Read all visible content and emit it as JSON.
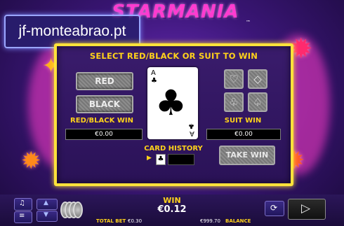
{
  "header": {
    "game_logo": "STARMANIA",
    "trademark": "™"
  },
  "watermark": {
    "text": "jf-monteabrao.pt"
  },
  "gamble": {
    "instruction": "SELECT RED/BLACK OR SUIT TO WIN",
    "red_button": "RED",
    "black_button": "BLACK",
    "red_black_win_label": "RED/BLACK WIN",
    "red_black_win_value": "€0.00",
    "suit_win_label": "SUIT WIN",
    "suit_win_value": "€0.00",
    "card": {
      "rank": "A",
      "suit": "♣"
    },
    "suits": [
      {
        "name": "hearts",
        "glyph": "♡"
      },
      {
        "name": "diamonds",
        "glyph": "◇"
      },
      {
        "name": "clubs",
        "glyph": "♧"
      },
      {
        "name": "spades",
        "glyph": "♤"
      }
    ],
    "card_history_label": "CARD HISTORY",
    "card_history": [
      "♣"
    ],
    "take_win_button": "TAKE WIN"
  },
  "bottom": {
    "win_label": "WIN",
    "win_value": "€0.12",
    "total_bet_label": "TOTAL BET",
    "total_bet_value": "€0.30",
    "balance_value": "€999.70",
    "balance_label": "BALANCE"
  },
  "colors": {
    "accent_yellow": "#ffd21a",
    "frame_yellow": "#ffe23a",
    "logo_pink": "#ff3bd0"
  }
}
